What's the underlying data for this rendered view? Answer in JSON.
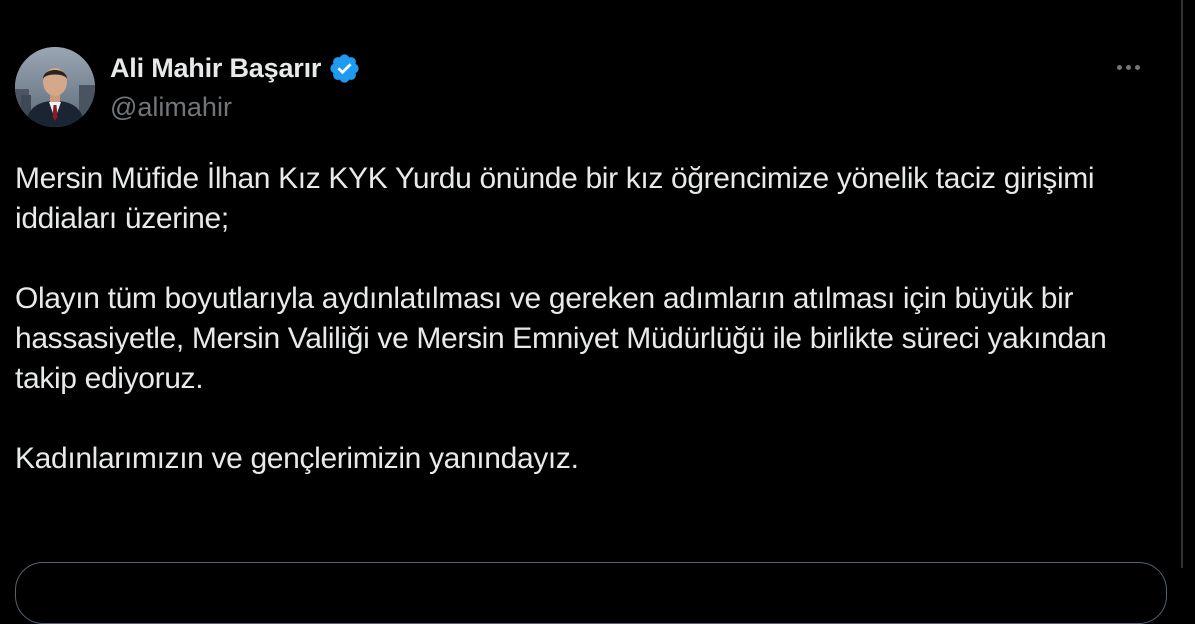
{
  "tweet": {
    "author": {
      "display_name": "Ali Mahir Başarır",
      "handle": "@alimahir",
      "verified": true
    },
    "paragraphs": [
      "Mersin Müfide İlhan Kız KYK Yurdu önünde bir kız öğrencimize yönelik taciz girişimi iddiaları üzerine;",
      "Olayın tüm boyutlarıyla aydınlatılması ve gereken adımların atılması için büyük bir hassasiyetle, Mersin Valiliği ve Mersin Emniyet Müdürlüğü ile birlikte süreci yakından takip ediyoruz.",
      "Kadınlarımızın ve gençlerimizin yanındayız."
    ]
  },
  "icons": {
    "verified": "verified-badge-icon",
    "more": "more-options-icon"
  },
  "colors": {
    "background": "#000000",
    "text_primary": "#e7e9ea",
    "text_secondary": "#71767b",
    "verified_blue": "#1d9bf0",
    "border": "#536471"
  }
}
